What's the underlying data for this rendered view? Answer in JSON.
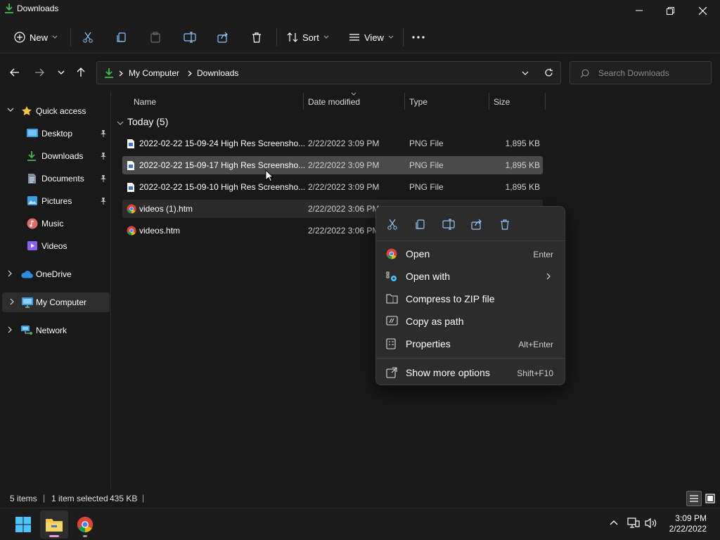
{
  "window": {
    "title": "Downloads"
  },
  "toolbar": {
    "new_label": "New",
    "sort_label": "Sort",
    "view_label": "View"
  },
  "address": {
    "crumbs": [
      "My Computer",
      "Downloads"
    ]
  },
  "search": {
    "placeholder": "Search Downloads"
  },
  "nav": {
    "quick_access": "Quick access",
    "items": [
      {
        "label": "Desktop",
        "pinned": true
      },
      {
        "label": "Downloads",
        "pinned": true
      },
      {
        "label": "Documents",
        "pinned": true
      },
      {
        "label": "Pictures",
        "pinned": true
      },
      {
        "label": "Music",
        "pinned": false
      },
      {
        "label": "Videos",
        "pinned": false
      }
    ],
    "onedrive": "OneDrive",
    "my_computer": "My Computer",
    "network": "Network"
  },
  "columns": {
    "name": "Name",
    "date": "Date modified",
    "type": "Type",
    "size": "Size"
  },
  "group": {
    "label": "Today (5)"
  },
  "files": [
    {
      "name": "2022-02-22 15-09-24 High Res Screensho...",
      "date": "2/22/2022 3:09 PM",
      "type": "PNG File",
      "size": "1,895 KB",
      "icon": "png-file-icon"
    },
    {
      "name": "2022-02-22 15-09-17 High Res Screensho...",
      "date": "2/22/2022 3:09 PM",
      "type": "PNG File",
      "size": "1,895 KB",
      "icon": "png-file-icon"
    },
    {
      "name": "2022-02-22 15-09-10 High Res Screensho...",
      "date": "2/22/2022 3:09 PM",
      "type": "PNG File",
      "size": "1,895 KB",
      "icon": "png-file-icon"
    },
    {
      "name": "videos (1).htm",
      "date": "2/22/2022 3:06 PM",
      "type": "",
      "size": "",
      "icon": "chrome-html-icon"
    },
    {
      "name": "videos.htm",
      "date": "2/22/2022 3:06 PM",
      "type": "",
      "size": "",
      "icon": "chrome-html-icon"
    }
  ],
  "context_menu": {
    "items": [
      {
        "label": "Open",
        "shortcut": "Enter"
      },
      {
        "label": "Open with",
        "shortcut": ""
      },
      {
        "label": "Compress to ZIP file",
        "shortcut": ""
      },
      {
        "label": "Copy as path",
        "shortcut": ""
      },
      {
        "label": "Properties",
        "shortcut": "Alt+Enter"
      },
      {
        "label": "Show more options",
        "shortcut": "Shift+F10"
      }
    ]
  },
  "status": {
    "count": "5 items",
    "selected": "1 item selected",
    "size": "435 KB"
  },
  "clock": {
    "time": "3:09 PM",
    "date": "2/22/2022"
  },
  "colors": {
    "accent": "#4cc2ff",
    "folder": "#f4c542",
    "selected_row": "#4a4a4a",
    "download_green": "#3fb950"
  }
}
